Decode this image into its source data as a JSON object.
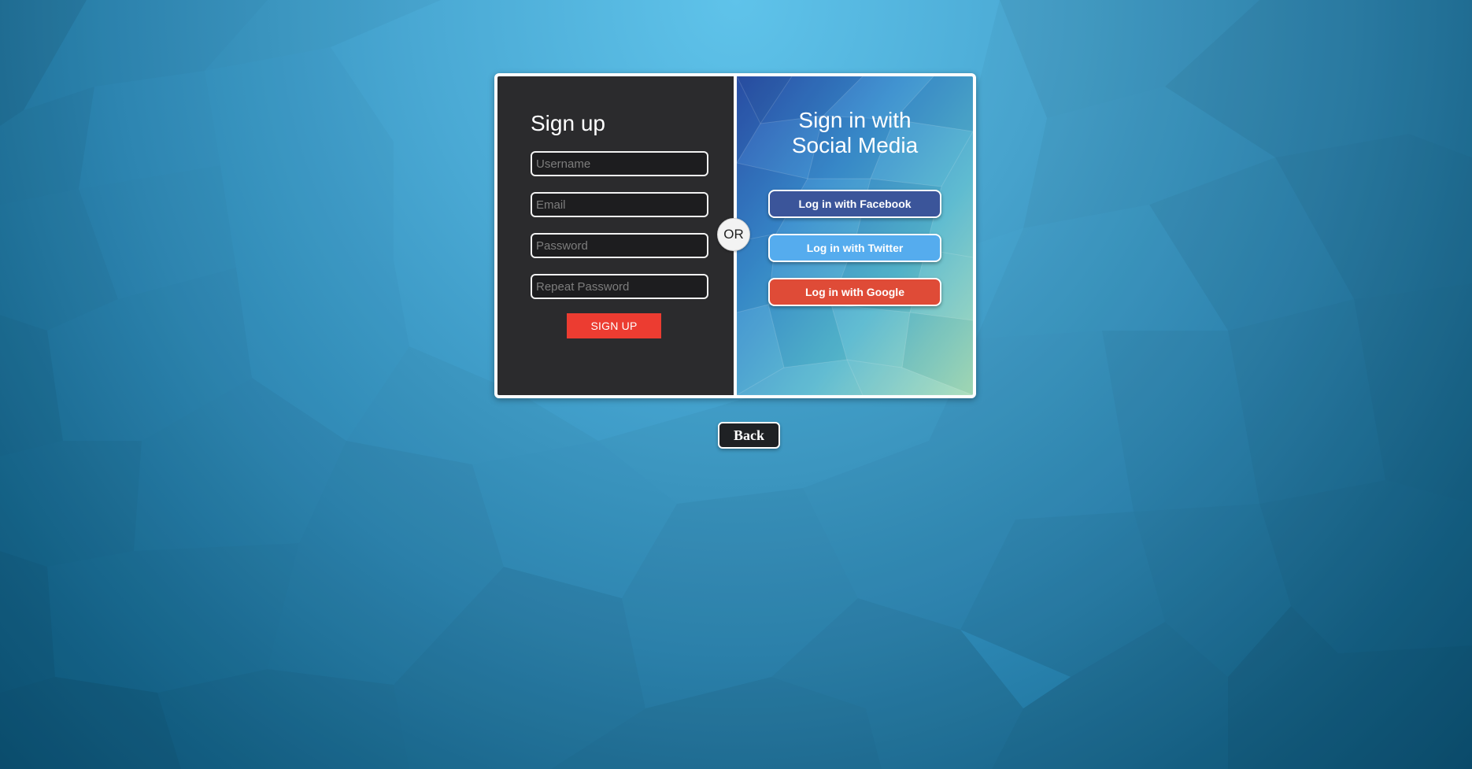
{
  "signup": {
    "title": "Sign up",
    "fields": [
      {
        "placeholder": "Username",
        "value": ""
      },
      {
        "placeholder": "Email",
        "value": ""
      },
      {
        "placeholder": "Password",
        "value": ""
      },
      {
        "placeholder": "Repeat Password",
        "value": ""
      }
    ],
    "submit_label": "SIGN UP",
    "submit_color": "#ec3c31"
  },
  "separator": {
    "label": "OR"
  },
  "social": {
    "title_line1": "Sign in with",
    "title_line2": "Social Media",
    "buttons": [
      {
        "label": "Log in with Facebook",
        "color": "#3b559a",
        "icon": "facebook"
      },
      {
        "label": "Log in with Twitter",
        "color": "#55acee",
        "icon": "twitter"
      },
      {
        "label": "Log in with Google",
        "color": "#df4b37",
        "icon": "google"
      }
    ]
  },
  "back": {
    "label": "Back"
  },
  "colors": {
    "panel_dark": "#2b2b2d",
    "background_light": "#5fc3ea",
    "background_dark": "#0d5a80"
  }
}
